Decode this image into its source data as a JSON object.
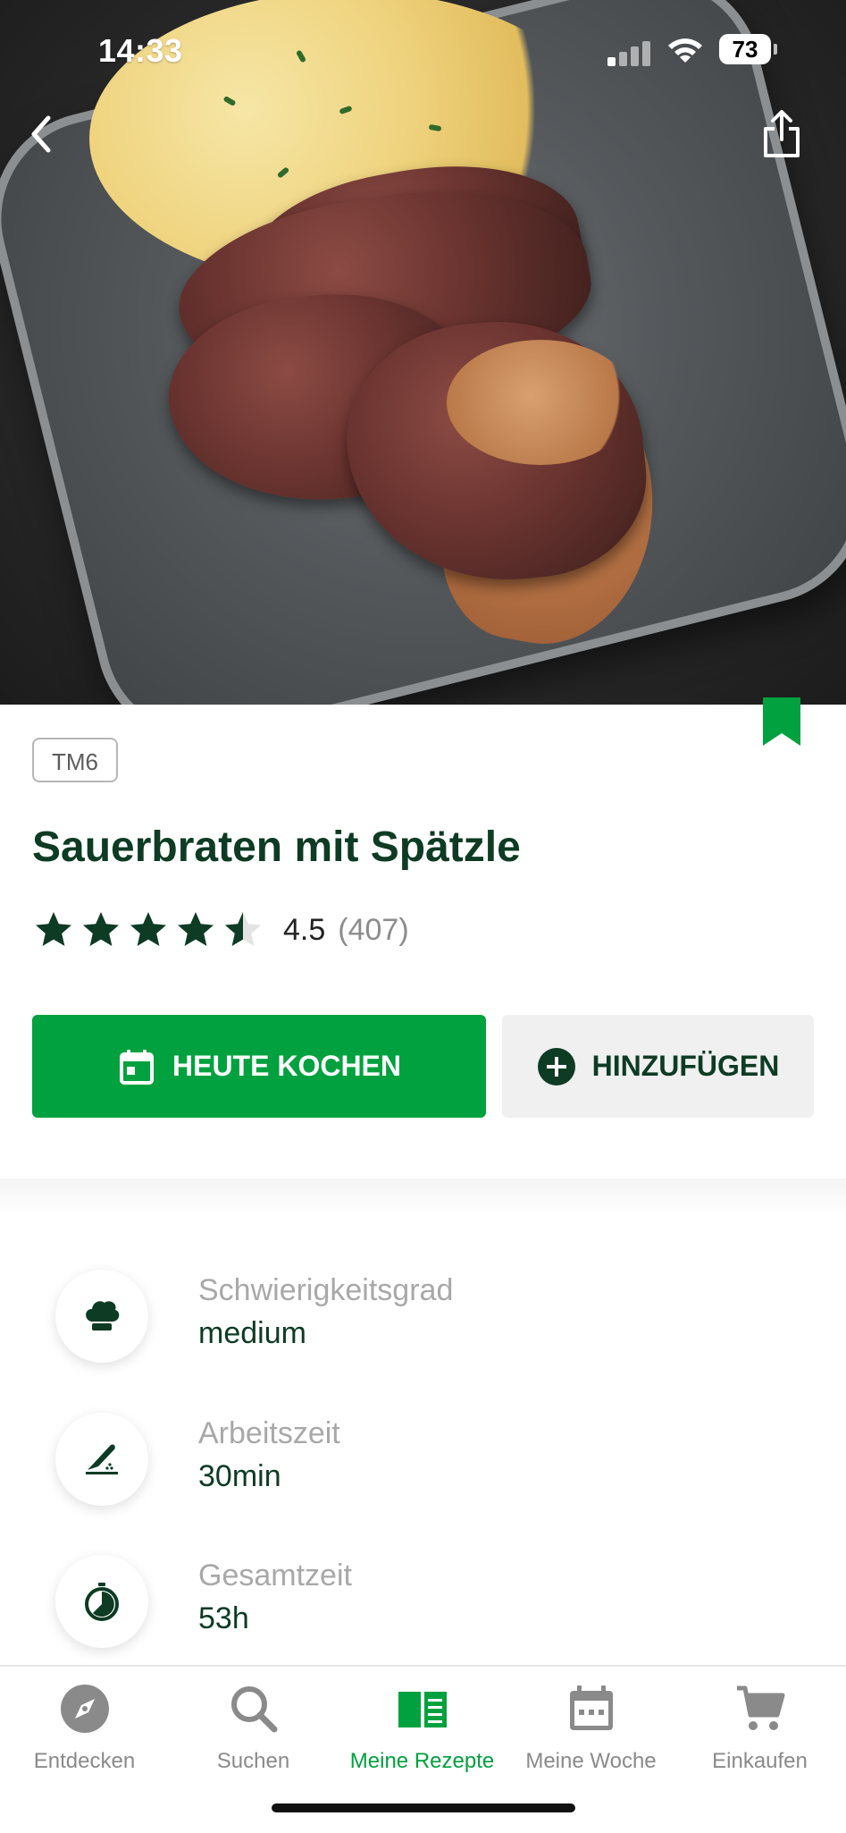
{
  "status_bar": {
    "time": "14:33",
    "battery": "73"
  },
  "recipe": {
    "badge": "TM6",
    "title": "Sauerbraten mit Spätzle",
    "rating_value": "4.5",
    "rating_count": "(407)",
    "rating": 4.5
  },
  "actions": {
    "cook_today": "HEUTE KOCHEN",
    "add": "HINZUFÜGEN"
  },
  "details": [
    {
      "label": "Schwierigkeitsgrad",
      "value": "medium",
      "icon": "chef-hat-icon"
    },
    {
      "label": "Arbeitszeit",
      "value": "30min",
      "icon": "knife-icon"
    },
    {
      "label": "Gesamtzeit",
      "value": "53h",
      "icon": "timer-icon"
    }
  ],
  "tabs": [
    {
      "label": "Entdecken",
      "icon": "compass-icon"
    },
    {
      "label": "Suchen",
      "icon": "search-icon"
    },
    {
      "label": "Meine Rezepte",
      "icon": "open-book-icon",
      "active": true
    },
    {
      "label": "Meine Woche",
      "icon": "calendar-icon"
    },
    {
      "label": "Einkaufen",
      "icon": "cart-icon"
    }
  ],
  "colors": {
    "accent": "#00a13e",
    "title": "#0d3b24",
    "secondary_button": "#f0f0f0"
  }
}
